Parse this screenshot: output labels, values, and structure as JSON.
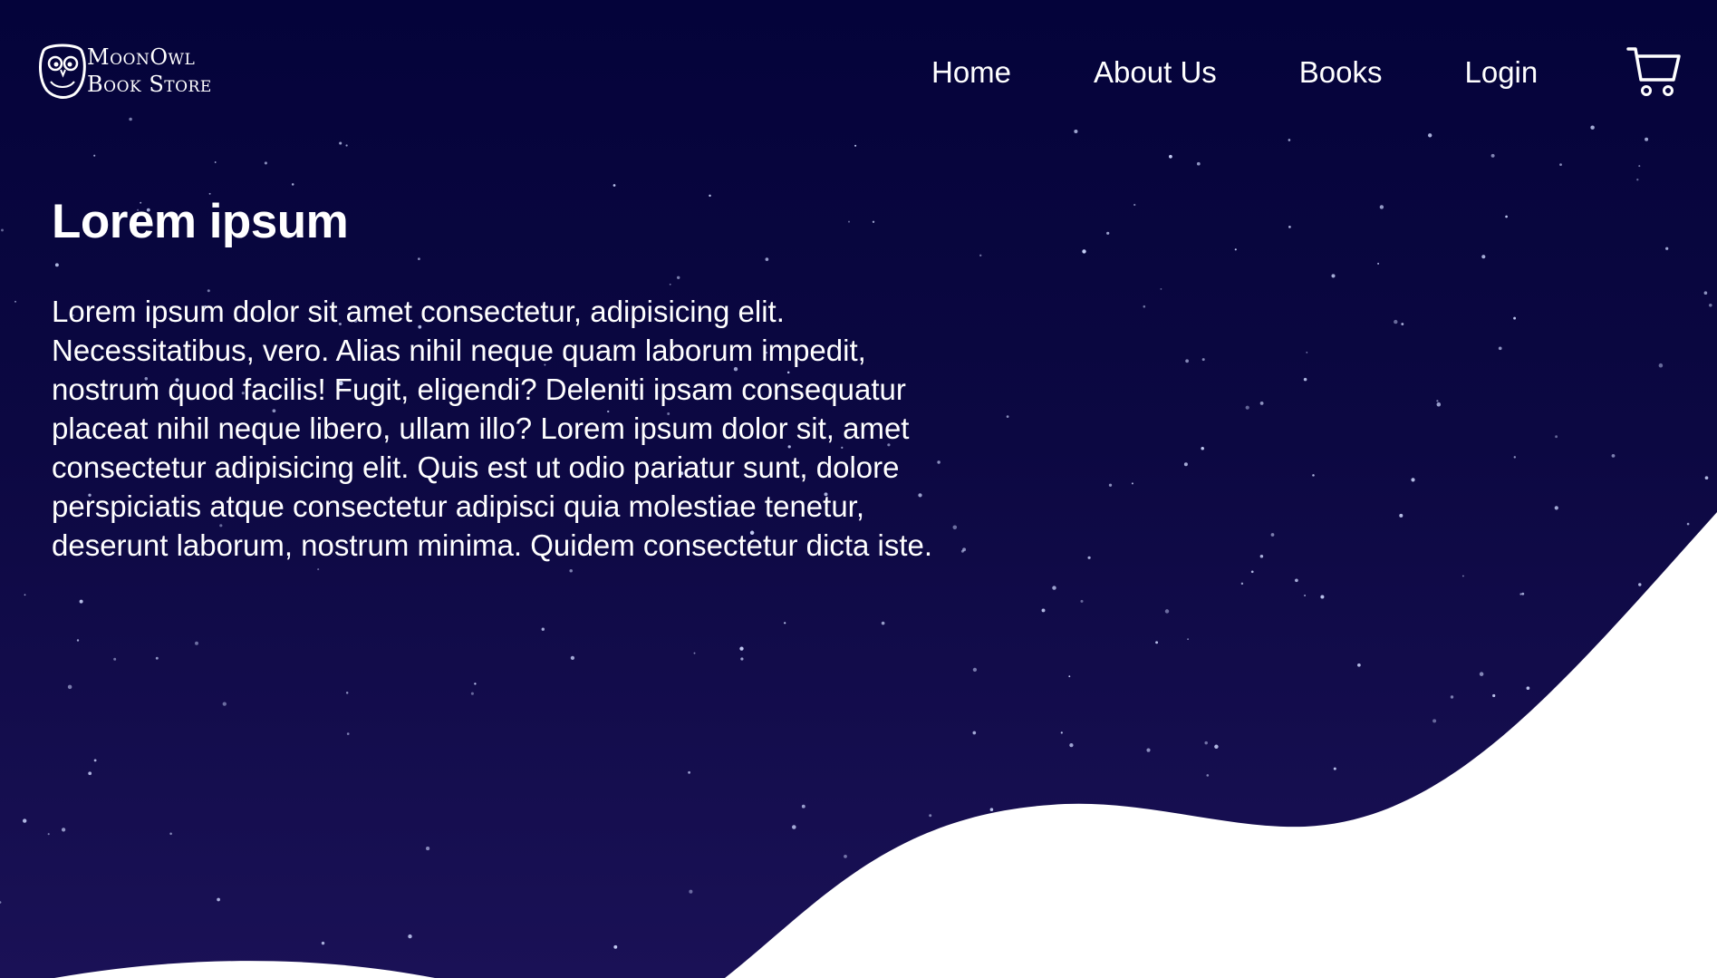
{
  "brand": {
    "line1": "MoonOwl",
    "line2": "Book Store",
    "logo_icon": "owl-icon"
  },
  "nav": {
    "items": [
      {
        "label": "Home"
      },
      {
        "label": "About Us"
      },
      {
        "label": "Books"
      },
      {
        "label": "Login"
      }
    ],
    "cart_icon": "shopping-cart-icon"
  },
  "hero": {
    "title": "Lorem ipsum",
    "body": "Lorem ipsum dolor sit amet consectetur, adipisicing elit. Necessitatibus, vero. Alias nihil neque quam laborum impedit, nostrum quod facilis! Fugit, eligendi? Deleniti ipsam consequatur placeat nihil neque libero, ullam illo? Lorem ipsum dolor sit, amet consectetur adipisicing elit. Quis est ut odio pariatur sunt, dolore perspiciatis atque consectetur adipisci quia molestiae tenetur, deserunt laborum, nostrum minima. Quidem consectetur dicta iste."
  },
  "colors": {
    "sky_top": "#04033a",
    "sky_bottom": "#1a1156",
    "wave": "#ffffff",
    "star": "#cfd8ff"
  }
}
